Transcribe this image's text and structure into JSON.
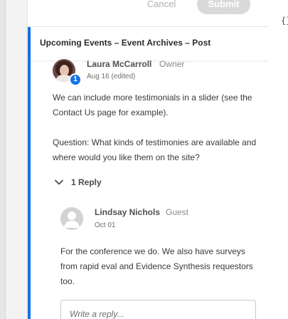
{
  "form": {
    "cancel_label": "Cancel",
    "submit_label": "Submit"
  },
  "thread": {
    "title": "Upcoming Events – Event Archives – Post",
    "comment": {
      "author": "Laura McCarroll",
      "role": "Owner",
      "date": "Aug 16 (edited)",
      "badge_count": "1",
      "paragraph1": "We can include more testimonials in a slider (see the Contact Us page for example).",
      "paragraph2": "Question: What kinds of testimonies are available and where would you like them on the site?"
    },
    "replies_label": "1 Reply",
    "reply": {
      "author": "Lindsay Nichols",
      "role": "Guest",
      "date": "Oct 01",
      "text": "For the conference we do. We also have surveys from rapid eval and Evidence Synthesis requestors too."
    },
    "reply_input_placeholder": "Write a reply..."
  },
  "code_snippet": "{}",
  "colors": {
    "accent": "#1473e6",
    "submit_disabled": "#d9d9d9"
  },
  "icons": {
    "replies_toggle": "chevron-down-icon",
    "guest_avatar": "user-silhouette-icon"
  }
}
